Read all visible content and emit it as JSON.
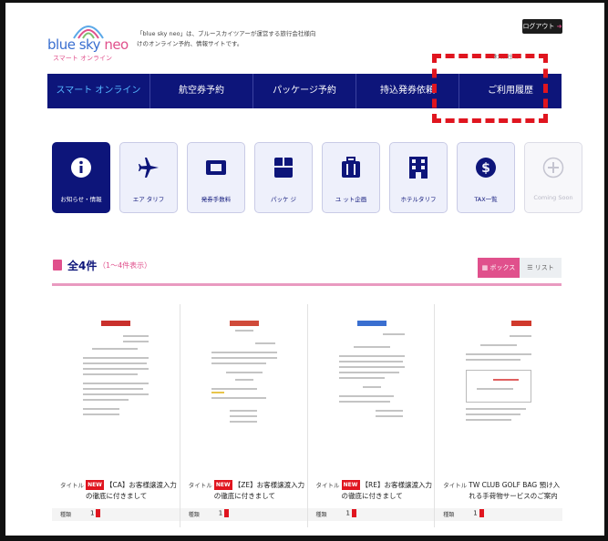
{
  "header": {
    "logo_main": "blue sky ",
    "logo_accent": "neo",
    "logo_sub": "スマート オンライン",
    "tagline": "「blue sky neo」は、ブルースカイツアーが運営する旅行会社様向けのオンライン予約、情報サイトです。",
    "logout_label": "ログアウト",
    "user_text": "株式会社 様"
  },
  "nav": {
    "items": [
      {
        "label": "スマート オンライン"
      },
      {
        "label": "航空券予約"
      },
      {
        "label": "パッケージ予約"
      },
      {
        "label": "持込発券依頼"
      },
      {
        "label": "ご利用履歴"
      }
    ]
  },
  "tiles": [
    {
      "label": "お知らせ・情報",
      "icon": "info-icon"
    },
    {
      "label": "エア タリフ",
      "icon": "airplane-icon"
    },
    {
      "label": "発券手数料",
      "icon": "ticket-icon"
    },
    {
      "label": "パッケ ジ",
      "icon": "package-icon"
    },
    {
      "label": "ユ ット企画",
      "icon": "luggage-icon"
    },
    {
      "label": "ホテルタリフ",
      "icon": "hotel-icon"
    },
    {
      "label": "TAX一覧",
      "icon": "dollar-icon"
    },
    {
      "label": "Coming Soon",
      "icon": "plus-circle-icon"
    }
  ],
  "results": {
    "count": "全4件",
    "range": "（1～4件表示）",
    "view_box": "ボックス",
    "view_list": "リスト"
  },
  "cards": [
    {
      "title_label": "タイトル",
      "badge": "NEW",
      "title": "【CA】お客様譲渡入力の徹底に付きまして",
      "meta_label": "種類",
      "meta_value": "1"
    },
    {
      "title_label": "タイトル",
      "badge": "NEW",
      "title": "【ZE】お客様譲渡入力の徹底に付きまして",
      "meta_label": "種類",
      "meta_value": "1"
    },
    {
      "title_label": "タイトル",
      "badge": "NEW",
      "title": "【RE】お客様譲渡入力の徹底に付きまして",
      "meta_label": "種類",
      "meta_value": "1"
    },
    {
      "title_label": "タイトル",
      "badge": "",
      "title": "TW CLUB GOLF BAG 預け入れる手荷物サービスのご案内",
      "meta_label": "種類",
      "meta_value": "1"
    }
  ],
  "colors": {
    "navy": "#0d157a",
    "accent_pink": "#e0508c",
    "alert_red": "#e0151f"
  }
}
